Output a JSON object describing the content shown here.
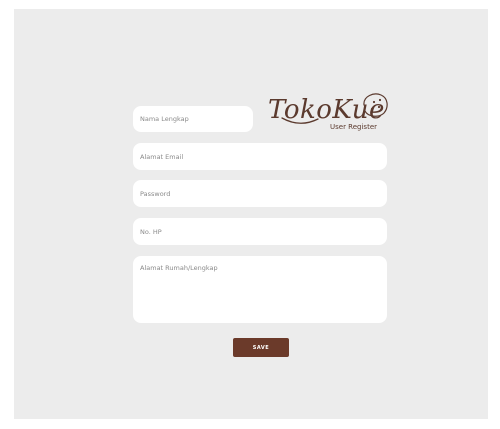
{
  "brand": {
    "name": "TokoKue",
    "subtitle": "User Register"
  },
  "form": {
    "name_placeholder": "Nama Lengkap",
    "email_placeholder": "Alamat Email",
    "password_placeholder": "Password",
    "phone_placeholder": "No. HP",
    "address_placeholder": "Alamat Rumah/Lengkap",
    "save_label": "SAVE"
  },
  "colors": {
    "background": "#ececec",
    "accent": "#6b3a2a",
    "brand_text": "#5b3a2e"
  }
}
